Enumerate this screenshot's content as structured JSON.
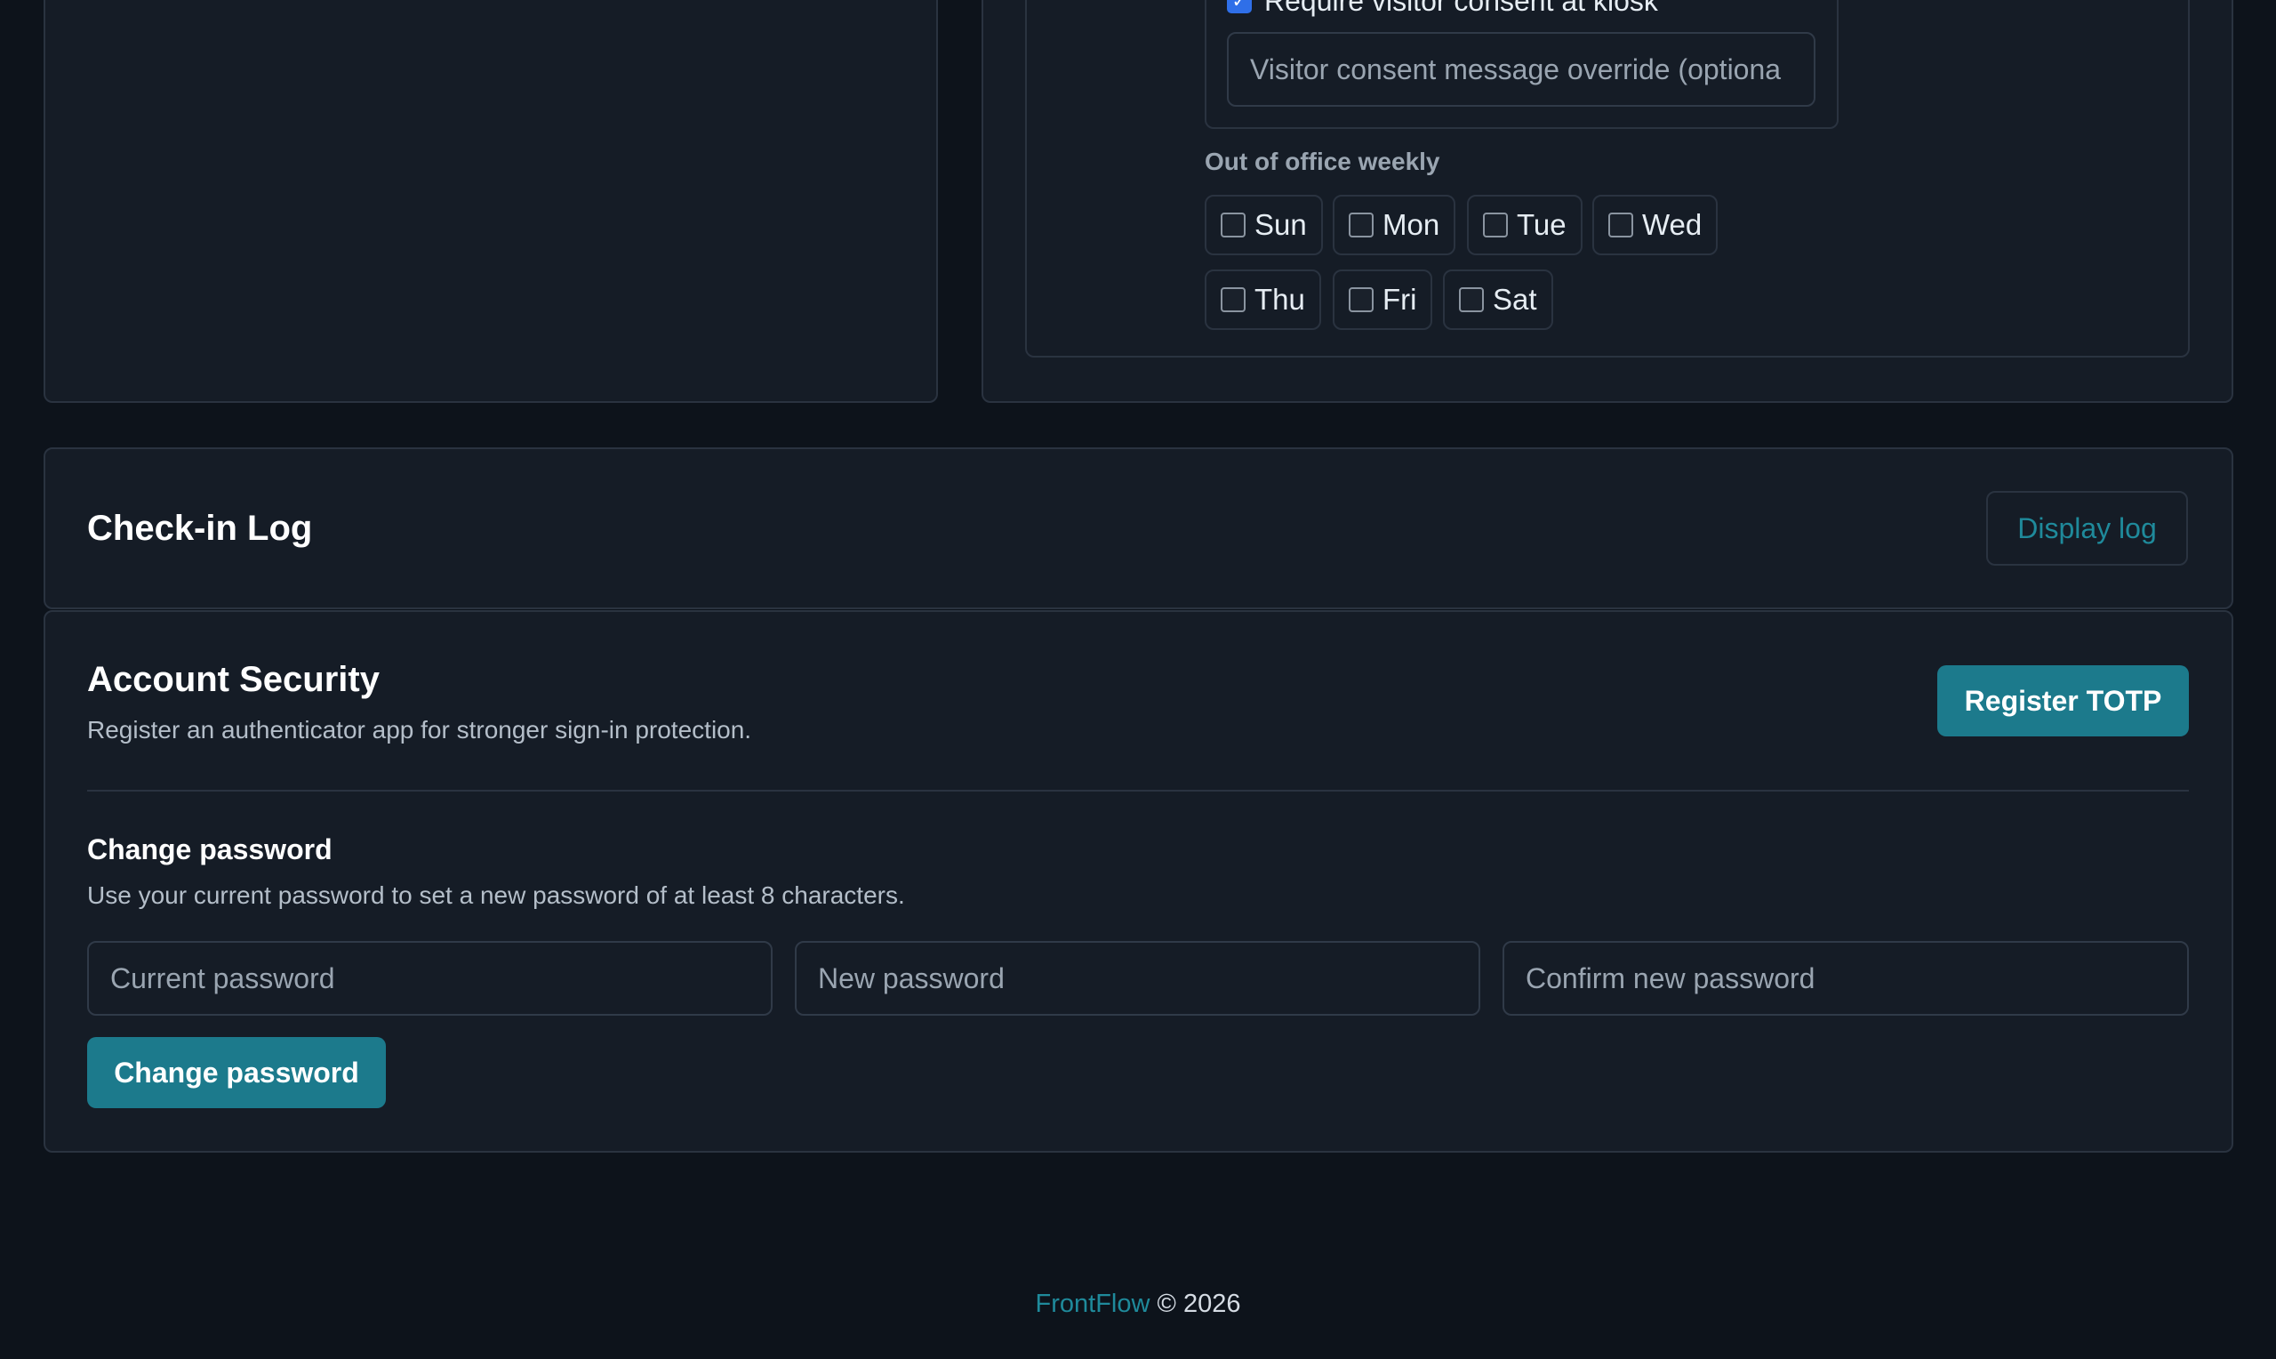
{
  "consent": {
    "checkbox_label": "Require visitor consent at kiosk",
    "override_placeholder": "Visitor consent message override (optiona"
  },
  "out_of_office": {
    "label": "Out of office weekly",
    "days": [
      "Sun",
      "Mon",
      "Tue",
      "Wed",
      "Thu",
      "Fri",
      "Sat"
    ]
  },
  "checkin_log": {
    "title": "Check-in Log",
    "display_button": "Display log"
  },
  "security": {
    "title": "Account Security",
    "description": "Register an authenticator app for stronger sign-in protection.",
    "register_button": "Register TOTP",
    "change_password": {
      "title": "Change password",
      "description": "Use your current password to set a new password of at least 8 characters.",
      "current_placeholder": "Current password",
      "new_placeholder": "New password",
      "confirm_placeholder": "Confirm new password",
      "submit_button": "Change password"
    }
  },
  "footer": {
    "brand": "FrontFlow",
    "copyright": "© 2026"
  },
  "colors": {
    "background": "#0d131b",
    "card": "#151c26",
    "accent": "#1c7a8c",
    "link": "#1f8a9b"
  }
}
